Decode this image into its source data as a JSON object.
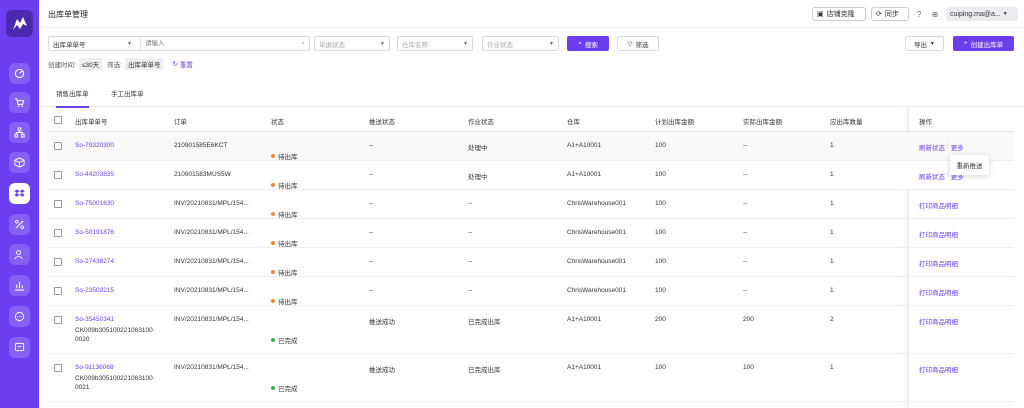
{
  "app": {
    "page_title": "出库单管理"
  },
  "topbar": {
    "store_clone_label": "店铺克隆",
    "sync_label": "同步",
    "user_name": "cuiping.ma@a..."
  },
  "filters": {
    "field_select": "出库单单号",
    "search_placeholder": "请输入",
    "status_placeholder": "单据状态",
    "warehouse_placeholder": "仓库名称",
    "work_status_placeholder": "作业状态",
    "search_label": "搜索",
    "filter_label": "筛选",
    "export_label": "导出",
    "create_label": "创建出库单",
    "created_time_label": "创建时间:",
    "created_time_value": "≤30天",
    "filter_label2": "筛选:",
    "filter_value": "出库单单号",
    "reset_label": "重置"
  },
  "tabs": [
    {
      "label": "销售出库单"
    },
    {
      "label": "手工出库单"
    }
  ],
  "table": {
    "headers": [
      "出库单单号",
      "订单",
      "状态",
      "推送状态",
      "作业状态",
      "仓库",
      "计划出库金额",
      "实际出库金额",
      "应出库数量",
      "操作"
    ],
    "rows": [
      {
        "no": "So-79320300",
        "sub": "",
        "order": "210901585E6KCT",
        "status": "待出库",
        "status_color": "#f08a3c",
        "push": "--",
        "work": "处理中",
        "wh": "A1+A10001",
        "plan": "100",
        "actual": "--",
        "qty": "1",
        "op1": "刷新状态",
        "op2": "更多"
      },
      {
        "no": "So-44203835",
        "sub": "",
        "order": "210901583MUS5W",
        "status": "待出库",
        "status_color": "#f08a3c",
        "push": "--",
        "work": "处理中",
        "wh": "A1+A10001",
        "plan": "100",
        "actual": "--",
        "qty": "1",
        "op1": "刷新状态",
        "op2": "更多"
      },
      {
        "no": "So-75001630",
        "sub": "",
        "order": "INV/20210831/MPL/154...",
        "status": "待出库",
        "status_color": "#f08a3c",
        "push": "--",
        "work": "--",
        "wh": "ChrisWarehouse001",
        "plan": "100",
        "actual": "--",
        "qty": "1",
        "op1": "打印商品明细",
        "op2": ""
      },
      {
        "no": "So-50191876",
        "sub": "",
        "order": "INV/20210831/MPL/154...",
        "status": "待出库",
        "status_color": "#f08a3c",
        "push": "--",
        "work": "--",
        "wh": "ChrisWarehouse001",
        "plan": "100",
        "actual": "--",
        "qty": "1",
        "op1": "打印商品明细",
        "op2": ""
      },
      {
        "no": "So-27438274",
        "sub": "",
        "order": "INV/20210831/MPL/154...",
        "status": "待出库",
        "status_color": "#f08a3c",
        "push": "--",
        "work": "--",
        "wh": "ChrisWarehouse001",
        "plan": "100",
        "actual": "--",
        "qty": "1",
        "op1": "打印商品明细",
        "op2": ""
      },
      {
        "no": "So-23503215",
        "sub": "",
        "order": "INV/20210831/MPL/154...",
        "status": "待出库",
        "status_color": "#f08a3c",
        "push": "--",
        "work": "--",
        "wh": "ChrisWarehouse001",
        "plan": "100",
        "actual": "--",
        "qty": "1",
        "op1": "打印商品明细",
        "op2": ""
      },
      {
        "no": "So-35450341",
        "sub": "CK009b305100221083100 0020",
        "order": "INV/20210831/MPL/154...",
        "status": "已完成",
        "status_color": "#3bb55c",
        "push": "推送成功",
        "work": "已完成出库",
        "wh": "A1+A10001",
        "plan": "200",
        "actual": "200",
        "qty": "2",
        "op1": "打印商品明细",
        "op2": ""
      },
      {
        "no": "So-91136068",
        "sub": "CK009b305100221083100 0021",
        "order": "INV/20210831/MPL/154...",
        "status": "已完成",
        "status_color": "#3bb55c",
        "push": "推送成功",
        "work": "已完成出库",
        "wh": "A1+A10001",
        "plan": "100",
        "actual": "100",
        "qty": "1",
        "op1": "打印商品明细",
        "op2": ""
      }
    ]
  },
  "popover": {
    "label": "重新推送"
  },
  "colors": {
    "accent": "#6b3ff0",
    "pending": "#f08a3c",
    "done": "#3bb55c"
  }
}
